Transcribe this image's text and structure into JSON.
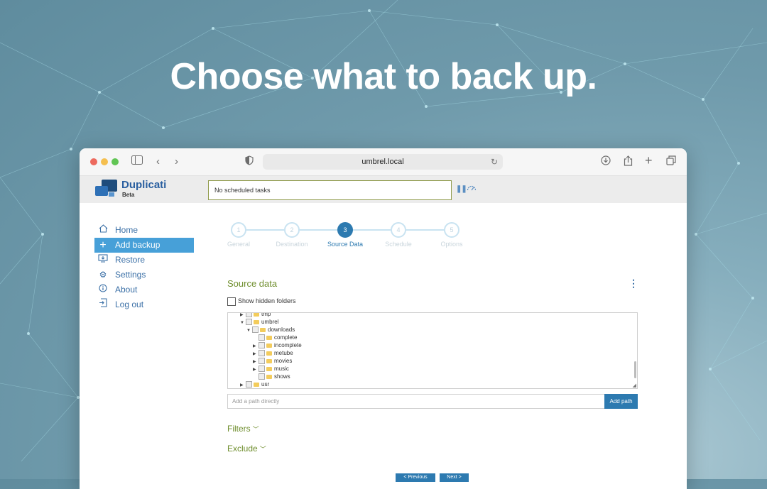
{
  "headline": "Choose what to back up.",
  "browser": {
    "url": "umbrel.local"
  },
  "app": {
    "brand": "Duplicati",
    "badge": "Beta",
    "status_text": "No scheduled tasks"
  },
  "sidebar": {
    "items": [
      {
        "label": "Home",
        "icon": "home-icon"
      },
      {
        "label": "Add backup",
        "icon": "plus-icon",
        "active": true
      },
      {
        "label": "Restore",
        "icon": "restore-icon"
      },
      {
        "label": "Settings",
        "icon": "gear-icon"
      },
      {
        "label": "About",
        "icon": "info-icon"
      },
      {
        "label": "Log out",
        "icon": "logout-icon"
      }
    ]
  },
  "wizard": {
    "steps": [
      {
        "number": "1",
        "label": "General"
      },
      {
        "number": "2",
        "label": "Destination"
      },
      {
        "number": "3",
        "label": "Source Data",
        "active": true
      },
      {
        "number": "4",
        "label": "Schedule"
      },
      {
        "number": "5",
        "label": "Options"
      }
    ]
  },
  "source": {
    "title": "Source data",
    "show_hidden_label": "Show hidden folders",
    "tree": [
      {
        "name": "tmp"
      },
      {
        "name": "umbrel"
      },
      {
        "name": "downloads"
      },
      {
        "name": "complete"
      },
      {
        "name": "incomplete"
      },
      {
        "name": "metube"
      },
      {
        "name": "movies"
      },
      {
        "name": "music"
      },
      {
        "name": "shows"
      },
      {
        "name": "usr"
      }
    ],
    "path_placeholder": "Add a path directly",
    "add_path_label": "Add path",
    "filters_label": "Filters",
    "exclude_label": "Exclude",
    "previous_label": "< Previous",
    "next_label": "Next >"
  },
  "colors": {
    "accent": "#2d7ab0",
    "active_nav": "#47a0d8",
    "section_green": "#6f8e2d"
  }
}
